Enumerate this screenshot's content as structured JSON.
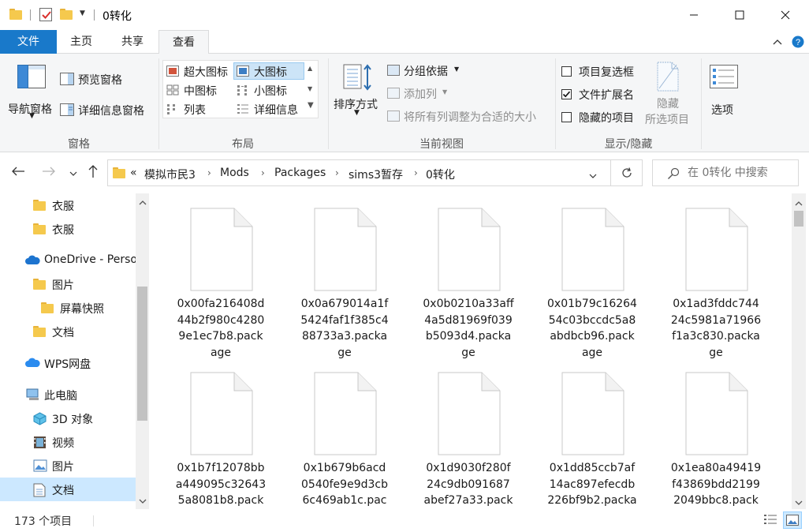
{
  "window": {
    "title": "0转化",
    "controls": {
      "minimize": "minimize-icon",
      "maximize": "maximize-icon",
      "close": "close-icon"
    }
  },
  "ribbon_tabs": [
    {
      "label": "文件",
      "active": false
    },
    {
      "label": "主页",
      "active": false
    },
    {
      "label": "共享",
      "active": false
    },
    {
      "label": "查看",
      "active": true
    }
  ],
  "ribbon": {
    "panes": {
      "group_label": "窗格",
      "navigation_pane": "导航窗格",
      "preview_pane": "预览窗格",
      "details_pane": "详细信息窗格"
    },
    "layout": {
      "group_label": "布局",
      "options": [
        "超大图标",
        "大图标",
        "中图标",
        "小图标",
        "列表",
        "详细信息"
      ],
      "selected": "大图标"
    },
    "current_view": {
      "group_label": "当前视图",
      "sort_by": "排序方式",
      "group_by": "分组依据",
      "add_columns": "添加列",
      "size_all_columns": "将所有列调整为合适的大小"
    },
    "show_hide": {
      "group_label": "显示/隐藏",
      "item_checkboxes": {
        "label": "项目复选框",
        "checked": false
      },
      "file_extensions": {
        "label": "文件扩展名",
        "checked": true
      },
      "hidden_items": {
        "label": "隐藏的项目",
        "checked": false
      },
      "hide_selected_line1": "隐藏",
      "hide_selected_line2": "所选项目"
    },
    "options": "选项"
  },
  "address": {
    "overflow": "«",
    "breadcrumbs": [
      "模拟市民3",
      "Mods",
      "Packages",
      "sims3暂存",
      "0转化"
    ]
  },
  "search": {
    "placeholder": "在 0转化 中搜索"
  },
  "sidebar": {
    "items": [
      {
        "label": "衣服",
        "icon": "folder-icon"
      },
      {
        "label": "衣服",
        "icon": "folder-icon"
      },
      {
        "label": "OneDrive - Perso",
        "icon": "onedrive-icon"
      },
      {
        "label": "图片",
        "icon": "folder-icon"
      },
      {
        "label": "屏幕快照",
        "icon": "folder-icon"
      },
      {
        "label": "文档",
        "icon": "folder-icon"
      },
      {
        "label": "WPS网盘",
        "icon": "wps-cloud-icon"
      },
      {
        "label": "此电脑",
        "icon": "computer-icon"
      },
      {
        "label": "3D 对象",
        "icon": "3d-objects-icon"
      },
      {
        "label": "视频",
        "icon": "video-icon"
      },
      {
        "label": "图片",
        "icon": "pictures-icon"
      },
      {
        "label": "文档",
        "icon": "documents-icon",
        "selected": true
      }
    ]
  },
  "files": [
    {
      "name": "0x00fa216408d44b2f980c42809e1ec7b8.package",
      "lines": [
        "0x00fa216408d",
        "44b2f980c4280",
        "9e1ec7b8.pack",
        "age"
      ]
    },
    {
      "name": "0x0a679014a1f5424faf1f385c488733a3.package",
      "lines": [
        "0x0a679014a1f",
        "5424faf1f385c4",
        "88733a3.packa",
        "ge"
      ]
    },
    {
      "name": "0x0b0210a33aff4a5d81969f039b5093d4.package",
      "lines": [
        "0x0b0210a33aff",
        "4a5d81969f039",
        "b5093d4.packa",
        "ge"
      ]
    },
    {
      "name": "0x01b79c1626454c03bccdc5a8abdbcb96.package",
      "lines": [
        "0x01b79c16264",
        "54c03bccdc5a8",
        "abdbcb96.pack",
        "age"
      ]
    },
    {
      "name": "0x1ad3fddc74424c5981a71966f1a3c830.package",
      "lines": [
        "0x1ad3fddc744",
        "24c5981a71966",
        "f1a3c830.packa",
        "ge"
      ]
    },
    {
      "name": "0x1b7f12078bba449095c326435a8081b8.pack",
      "lines": [
        "0x1b7f12078bb",
        "a449095c32643",
        "5a8081b8.pack"
      ]
    },
    {
      "name": "0x1b679b6acd0540fe9e9d3cb6c469ab1c.pac",
      "lines": [
        "0x1b679b6acd",
        "0540fe9e9d3cb",
        "6c469ab1c.pac"
      ]
    },
    {
      "name": "0x1d9030f280f24c9db091687abef27a33.pack",
      "lines": [
        "0x1d9030f280f",
        "24c9db091687",
        "abef27a33.pack"
      ]
    },
    {
      "name": "0x1dd85ccb7af14ac897efecdb226bf9b2.packa",
      "lines": [
        "0x1dd85ccb7af",
        "14ac897efecdb",
        "226bf9b2.packa"
      ]
    },
    {
      "name": "0x1ea80a49419f43869bdd21992049bbc8.pack",
      "lines": [
        "0x1ea80a49419",
        "f43869bdd2199",
        "2049bbc8.pack"
      ]
    }
  ],
  "status": {
    "item_count": "173 个项目"
  },
  "colors": {
    "accent": "#1979ca",
    "selection": "#cce8ff",
    "ribbon_bg": "#f5f6f7"
  }
}
